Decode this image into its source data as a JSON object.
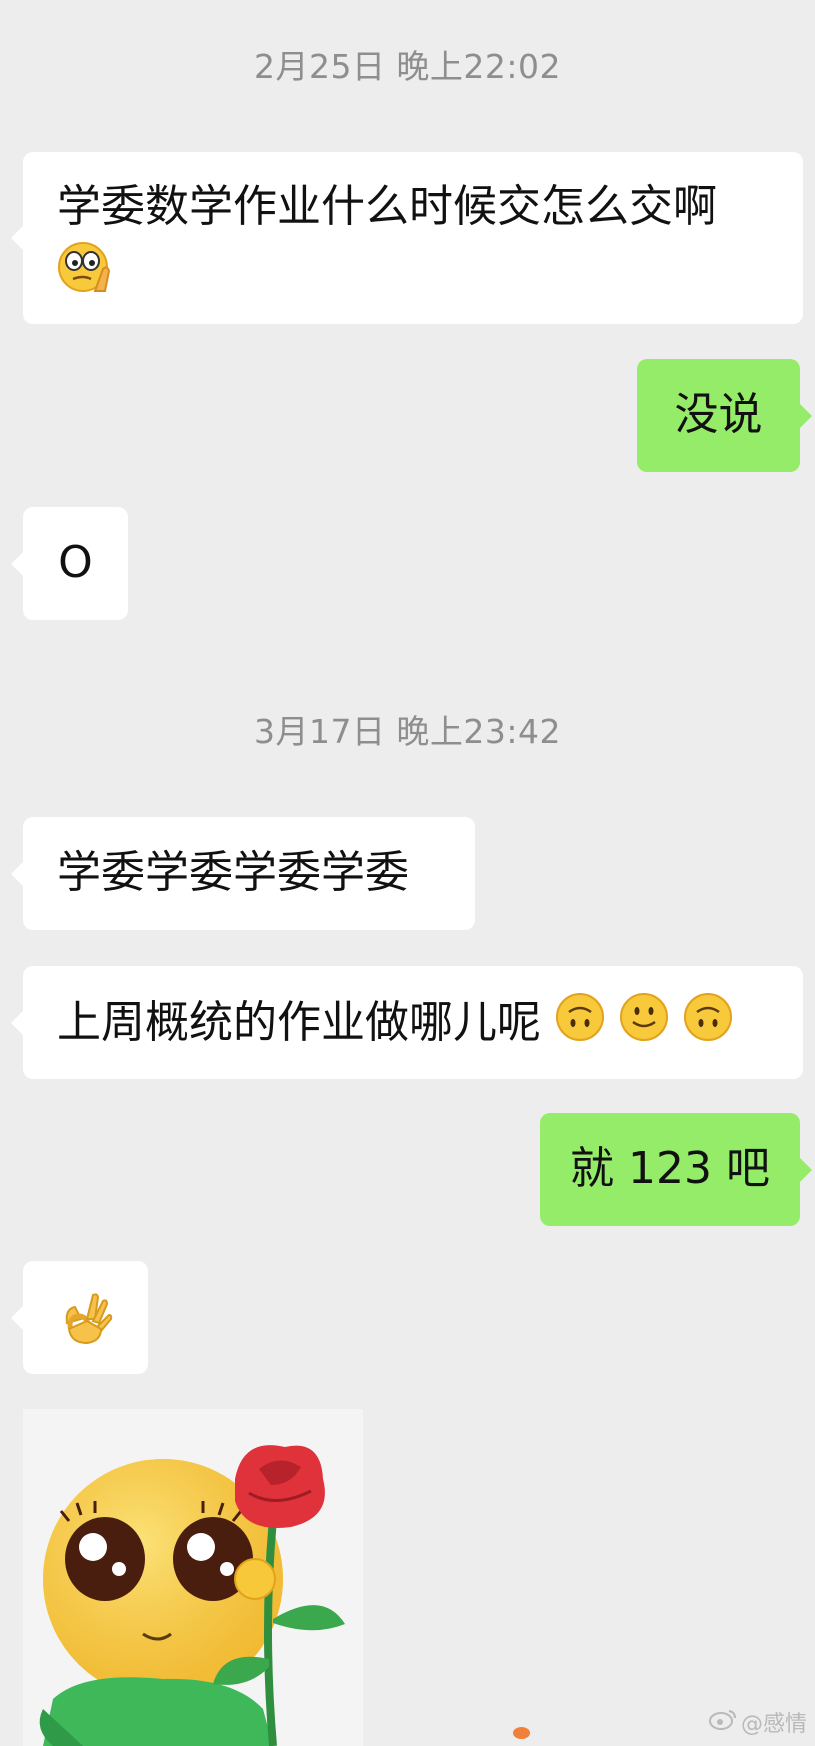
{
  "chat": {
    "timestamp_1": "2月25日 晚上22:02",
    "msg_1": "学委数学作业什么时候交怎么交啊",
    "msg_1_emoji": "thinking-face-icon",
    "msg_2": "没说",
    "msg_3": "O",
    "timestamp_2": "3月17日 晚上23:42",
    "msg_4": "学委学委学委学委",
    "msg_5": "上周概统的作业做哪儿呢",
    "msg_5_emojis": [
      "upside-down-face-icon",
      "slightly-smiling-face-icon",
      "upside-down-face-icon"
    ],
    "msg_6": "就 123 吧",
    "msg_7_emoji": "ok-hand-icon",
    "msg_8_sticker": "emoji-face-holding-rose-sticker"
  },
  "watermark": {
    "text": "@感情",
    "icon": "weibo-icon"
  },
  "colors": {
    "background": "#ededed",
    "incoming_bubble": "#ffffff",
    "outgoing_bubble": "#95ec69",
    "timestamp_text": "#8e8e8e"
  }
}
